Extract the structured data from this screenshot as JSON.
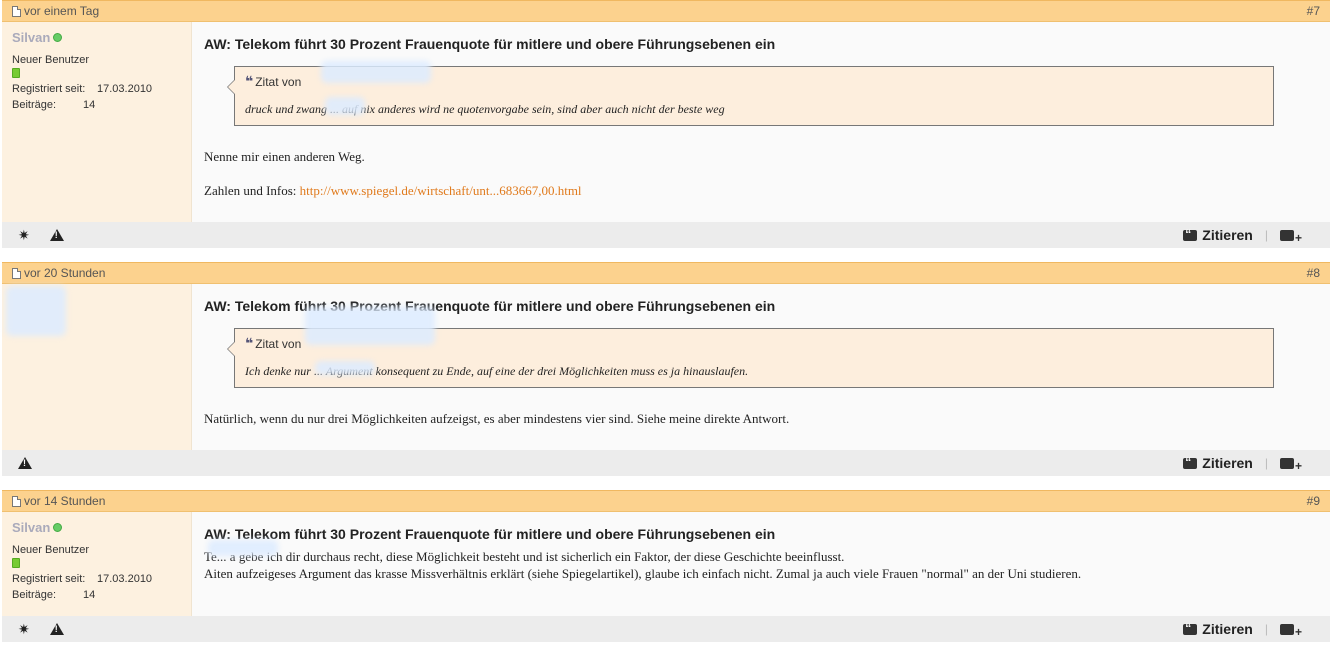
{
  "posts": [
    {
      "time": "vor einem Tag",
      "number": "#7",
      "author": {
        "name": "Silvan",
        "rank": "Neuer Benutzer",
        "registered_label": "Registriert seit:",
        "registered": "17.03.2010",
        "posts_label": "Beiträge:",
        "posts": "14"
      },
      "title": "AW: Telekom führt 30 Prozent Frauenquote für mitlere und obere Führungsebenen ein",
      "quote_label": "Zitat von",
      "quote_text": "druck und zwang ... auf nix anderes wird ne quotenvorgabe sein, sind aber auch nicht der beste weg",
      "paragraphs": [
        "Nenne mir einen anderen Weg."
      ],
      "link_prefix": "Zahlen und Infos: ",
      "link_text": "http://www.spiegel.de/wirtschaft/unt...683667,00.html"
    },
    {
      "time": "vor 20 Stunden",
      "number": "#8",
      "title": "AW: Telekom führt 30 Prozent Frauenquote für mitlere und obere Führungsebenen ein",
      "quote_label": "Zitat von",
      "quote_text": "Ich denke nur ... Argument konsequent zu Ende, auf eine der drei Möglichkeiten muss es ja hinauslaufen.",
      "paragraphs": [
        "Natürlich, wenn du nur drei Möglichkeiten aufzeigst, es aber mindestens vier sind. Siehe meine direkte Antwort."
      ]
    },
    {
      "time": "vor 14 Stunden",
      "number": "#9",
      "author": {
        "name": "Silvan",
        "rank": "Neuer Benutzer",
        "registered_label": "Registriert seit:",
        "registered": "17.03.2010",
        "posts_label": "Beiträge:",
        "posts": "14"
      },
      "title": "AW: Telekom führt 30 Prozent Frauenquote für mitlere und obere Führungsebenen ein",
      "paragraphs": [
        "Te... a gebe ich dir durchaus recht, diese Möglichkeit besteht und ist sicherlich ein Faktor, der diese Geschichte beeinflusst.",
        "Aiten aufzeigeses Argument das krasse Missverhältnis erklärt (siehe Spiegelartikel), glaube ich einfach nicht. Zumal ja auch viele Frauen \"normal\" an der Uni studieren."
      ]
    }
  ],
  "footer": {
    "quote_label": "Zitieren",
    "separator": "|"
  }
}
